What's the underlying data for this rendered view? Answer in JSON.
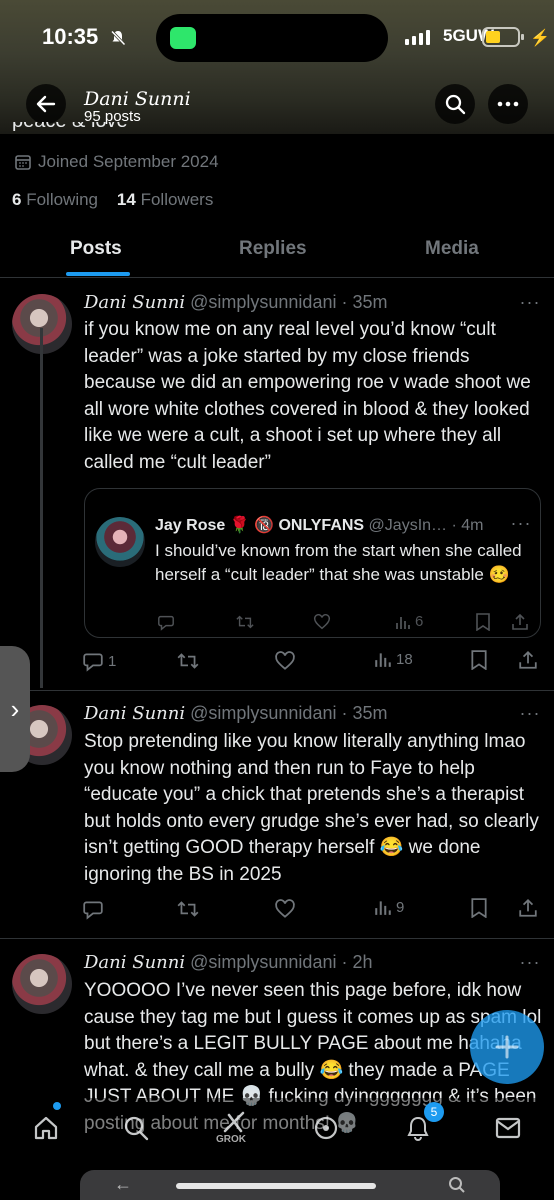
{
  "status_bar": {
    "time": "10:35",
    "network": "5GUW"
  },
  "header": {
    "name": "Dani Sunni",
    "posts_count": "95 posts"
  },
  "profile": {
    "bio_fragment": "peace & love",
    "joined": "Joined September 2024",
    "following_count": "6",
    "following_label": "Following",
    "followers_count": "14",
    "followers_label": "Followers"
  },
  "tabs": [
    {
      "label": "Posts",
      "active": true
    },
    {
      "label": "Replies",
      "active": false
    },
    {
      "label": "Media",
      "active": false
    }
  ],
  "posts": [
    {
      "display_name": "Dani Sunni",
      "handle": "@simplysunnidani",
      "time": "35m",
      "text": "if you know me on any real level you’d know “cult leader” was a joke started by my close friends because we did an empowering roe v wade shoot we all wore white clothes covered in blood & they looked like we were a cult, a shoot i set up where they all called me “cult leader”",
      "quote": {
        "display_name": "Jay Rose 🌹 🔞 ONLYFANS",
        "handle": "@JaysIn…",
        "time": "4m",
        "text": "I should’ve known from the start when she called herself a “cult leader” that she was unstable 🥴",
        "views": "6"
      },
      "replies": "1",
      "views": "18"
    },
    {
      "display_name": "Dani Sunni",
      "handle": "@simplysunnidani",
      "time": "35m",
      "text": "Stop pretending like you know literally anything lmao you know nothing and then run to Faye to help “educate you” a chick that pretends she’s a therapist but holds onto every grudge she’s ever had, so clearly isn’t getting GOOD therapy herself 😂 we done ignoring the BS in 2025",
      "views": "9"
    },
    {
      "display_name": "Dani Sunni",
      "handle": "@simplysunnidani",
      "time": "2h",
      "text": "YOOOOO I’ve never seen this page before, idk how cause they tag me but I guess it comes up as spam lol but there’s a LEGIT BULLY PAGE about me hahaha what. & they call me a bully 😂 they made a PAGE JUST ABOUT ME 💀 fucking dyinggggggg & it’s been posting about me for months! 💀"
    }
  ],
  "bottom_nav": {
    "grok_label": "GROK",
    "notifications_badge": "5"
  },
  "colors": {
    "accent": "#1d9bf0",
    "background": "#000000",
    "secondary_text": "#71767b",
    "divider": "#2f3336"
  }
}
